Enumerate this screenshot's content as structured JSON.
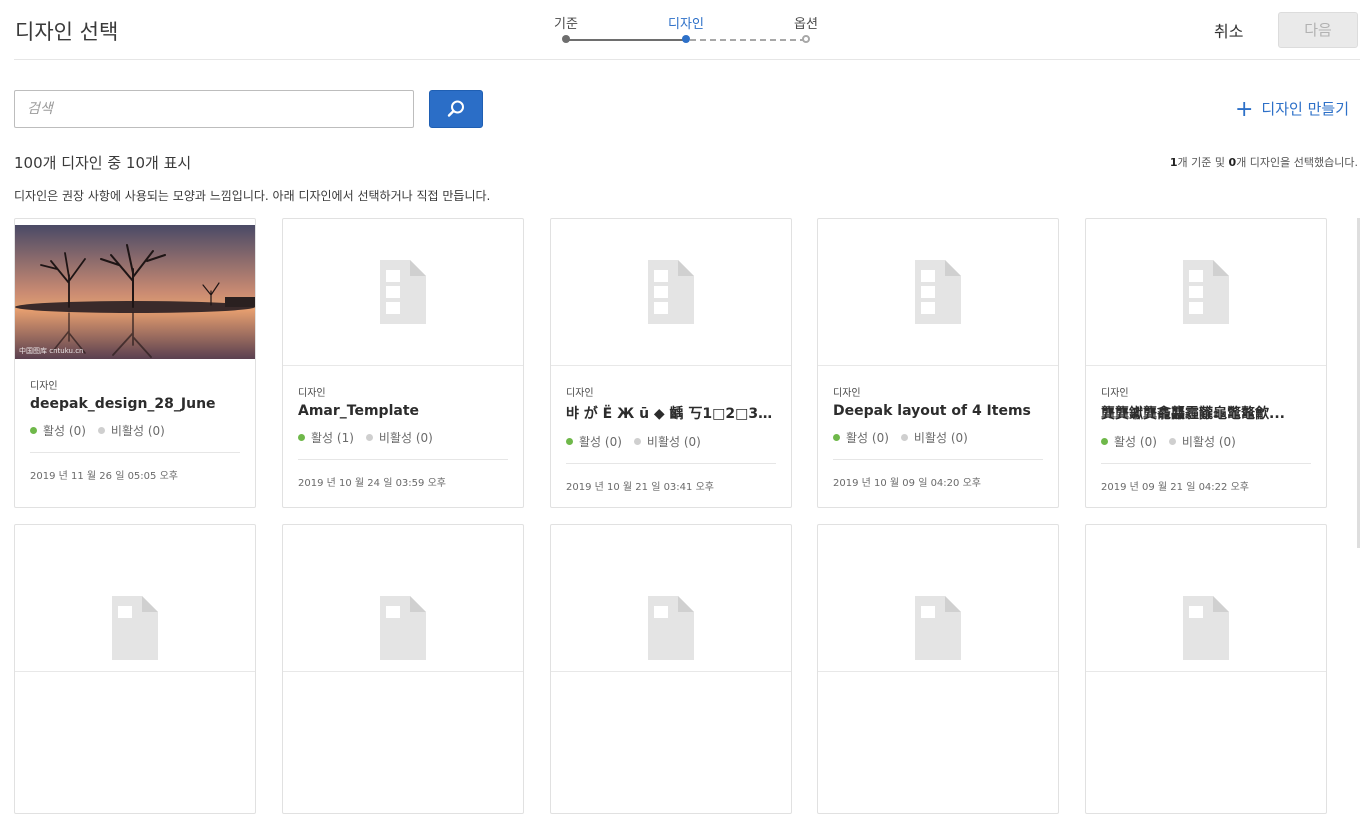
{
  "header": {
    "title": "디자인 선택",
    "steps": [
      {
        "label": "기준",
        "state": "done"
      },
      {
        "label": "디자인",
        "state": "active"
      },
      {
        "label": "옵션",
        "state": "todo"
      }
    ],
    "cancel_label": "취소",
    "next_label": "다음"
  },
  "toolbar": {
    "search_placeholder": "검색",
    "search_icon": "search-icon",
    "create_label": "디자인 만들기",
    "create_icon": "plus-icon"
  },
  "summary": {
    "count_text": "100개 디자인 중 10개 표시",
    "selected_criteria_count": "1",
    "selected_criteria_suffix": "개 기준 및 ",
    "selected_design_count": "0",
    "selected_design_suffix": "개 디자인을 선택했습니다.",
    "description": "디자인은 권장 사항에 사용되는 모양과 느낌입니다. 아래 디자인에서 선택하거나 직접 만듭니다."
  },
  "colors": {
    "accent": "#2d70c8",
    "active_dot": "#6fb84a",
    "inactive_dot": "#cfcfcf"
  },
  "cards": [
    {
      "type": "디자인",
      "name": "deepak_design_28_June",
      "active": "활성 (0)",
      "inactive": "비활성 (0)",
      "date": "2019 년 11 월 26 일 05:05 오후",
      "thumb": "photo",
      "watermark": "中国图库 cntuku.cn"
    },
    {
      "type": "디자인",
      "name": "Amar_Template",
      "active": "활성 (1)",
      "inactive": "비활성 (0)",
      "date": "2019 년 10 월 24 일 03:59 오후",
      "thumb": "document-icon"
    },
    {
      "type": "디자인",
      "name": "뱌 が Ë Ж ū ◆ 齲 丂1□2□3□北 拮...",
      "active": "활성 (0)",
      "inactive": "비활성 (0)",
      "date": "2019 년 10 월 21 일 03:41 오후",
      "thumb": "document-icon"
    },
    {
      "type": "디자인",
      "name": "Deepak layout of 4 Items",
      "active": "활성 (0)",
      "inactive": "비활성 (0)",
      "date": "2019 년 10 월 09 일 04:20 오후",
      "thumb": "document-icon"
    },
    {
      "type": "디자인",
      "name": "龔龔钀龔龕龘霾龖龜鼈鼇龡...",
      "active": "활성 (0)",
      "inactive": "비활성 (0)",
      "date": "2019 년 09 월 21 일 04:22 오후",
      "thumb": "document-icon"
    }
  ]
}
